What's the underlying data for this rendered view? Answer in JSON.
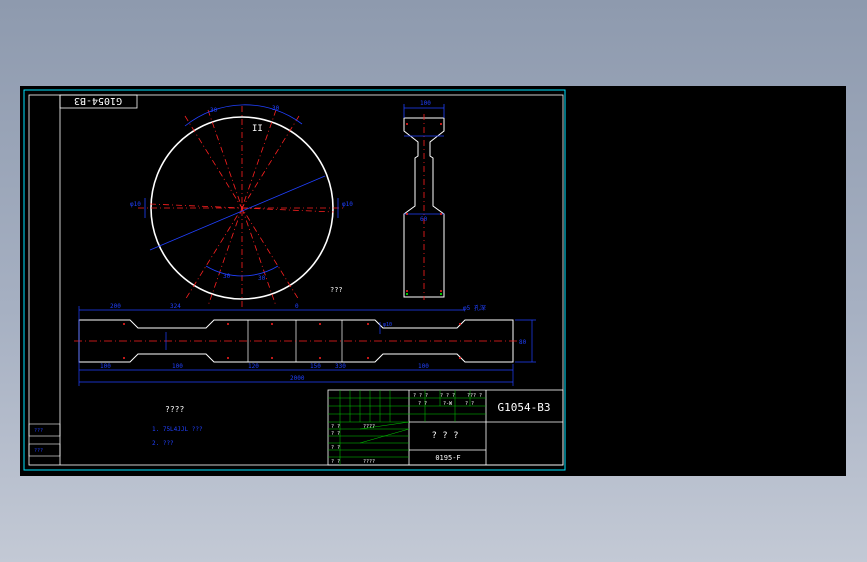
{
  "drawing": {
    "title_box_label": "G1054-B3",
    "top_view": {
      "label_top": "II",
      "dim_left_top": "30",
      "dim_right_top": "30",
      "dim_left": "φ10",
      "dim_right": "φ10",
      "dim_bottom_left": "30",
      "dim_bottom_right": "30",
      "note": "???"
    },
    "side_view": {
      "dim_top": "100",
      "dim_mid": "60"
    },
    "front_view": {
      "dims_top": [
        "200",
        "324",
        "0"
      ],
      "dims_bottom": [
        "100",
        "100",
        "120",
        "150",
        "330",
        "100"
      ],
      "overall": "2000",
      "height": "80",
      "callout": "φ5 孔深",
      "label_mid": "φ10"
    },
    "notes": {
      "heading": "????",
      "items": [
        "1. 75L4JJL ???",
        "2. ???"
      ]
    },
    "left_strip": [
      "???",
      "???"
    ],
    "title_block": {
      "drawing_number": "G1054-B3",
      "part_name": "? ? ?",
      "material": "0195-F",
      "header_cells": [
        "? ? ?",
        "? ? ?",
        "??? ?"
      ],
      "sub_cells": [
        "? ?",
        "?-W",
        "? ?"
      ],
      "rows": [
        "? ?",
        "? ?",
        "? ?",
        "? ?"
      ],
      "row_values": [
        "????",
        "????"
      ]
    }
  },
  "colors": {
    "background": "#000000",
    "border": "#ffffff",
    "frame": "#00ffff",
    "dimension": "#0000ff",
    "centerline": "#ff0000",
    "table_grid": "#00ff00"
  }
}
